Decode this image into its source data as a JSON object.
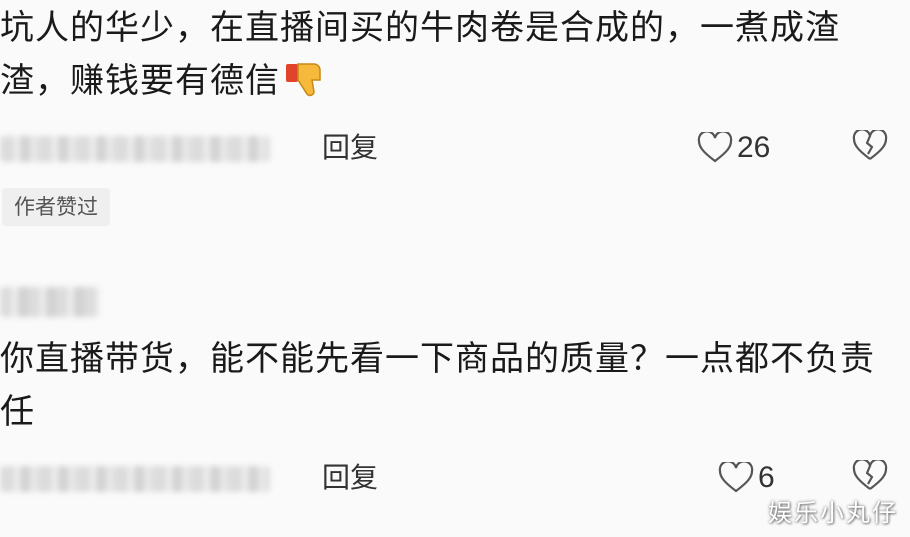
{
  "comments": [
    {
      "text": "坑人的华少，在直播间买的牛肉卷是合成的，一煮成渣渣，赚钱要有德信",
      "emoji_icon": "thumbs-down-emoji",
      "reply_label": "回复",
      "likes": "26",
      "badge": "作者赞过"
    },
    {
      "text": "你直播带货，能不能先看一下商品的质量？一点都不负责任",
      "reply_label": "回复",
      "likes": "6"
    }
  ],
  "watermark": "娱乐小丸仔",
  "colors": {
    "background": "#fafafa",
    "text": "#1a1a1a",
    "badge_bg": "#efefef"
  }
}
